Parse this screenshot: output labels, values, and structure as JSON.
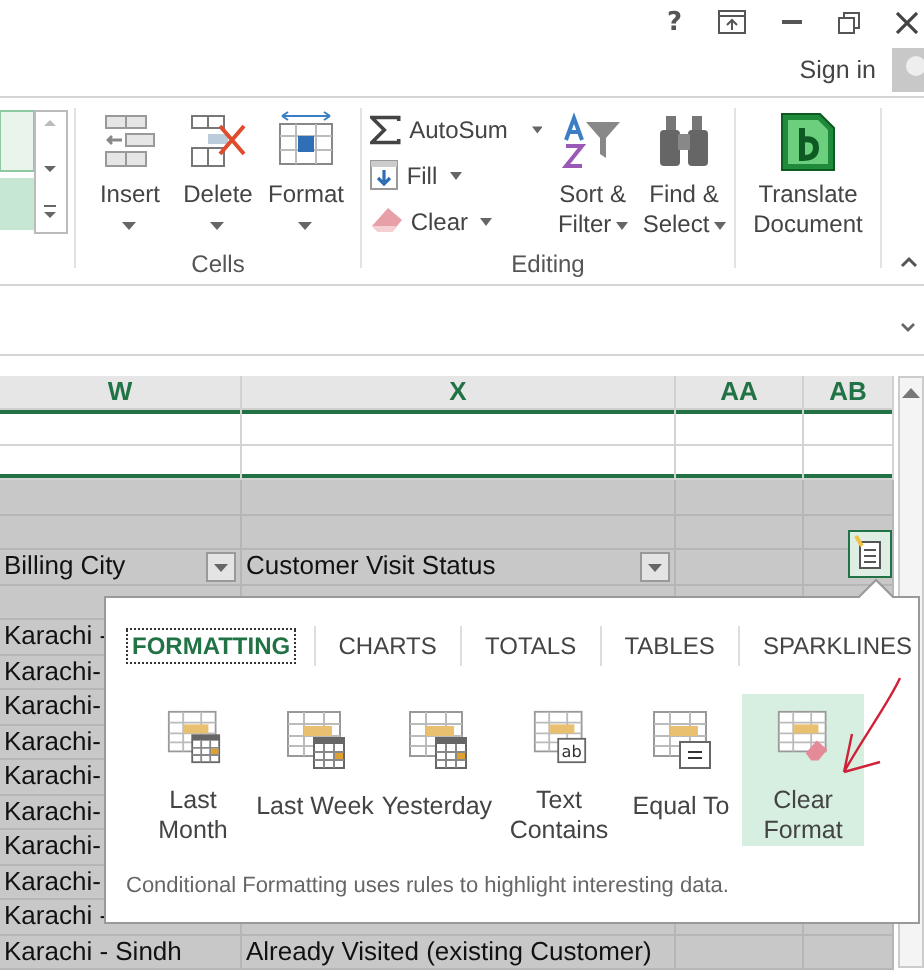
{
  "title_bar": {
    "help": "?"
  },
  "account": {
    "sign_in": "Sign in"
  },
  "ribbon": {
    "cells_group": {
      "label": "Cells",
      "buttons": [
        {
          "label": "Insert"
        },
        {
          "label": "Delete"
        },
        {
          "label": "Format"
        }
      ]
    },
    "editing_group": {
      "label": "Editing",
      "small_buttons": [
        {
          "label": "AutoSum"
        },
        {
          "label": "Fill"
        },
        {
          "label": "Clear"
        }
      ],
      "large_buttons": [
        {
          "lines": [
            "Sort &",
            "Filter"
          ]
        },
        {
          "lines": [
            "Find &",
            "Select"
          ]
        }
      ]
    },
    "translate_button": {
      "lines": [
        "Translate",
        "Document"
      ]
    }
  },
  "sheet": {
    "columns": [
      "W",
      "X",
      "AA",
      "AB"
    ],
    "header_row": [
      "Billing City",
      "Customer Visit Status"
    ],
    "rows": [
      [],
      [
        "Karachi -"
      ],
      [
        "Karachi-"
      ],
      [
        "Karachi-"
      ],
      [
        "Karachi-"
      ],
      [
        "Karachi-"
      ],
      [
        "Karachi-"
      ],
      [
        "Karachi-"
      ],
      [
        "Karachi-"
      ],
      [
        "Karachi -"
      ],
      [
        "Karachi - Sindh",
        "Already Visited (existing Customer)"
      ]
    ]
  },
  "quick_analysis": {
    "tabs": [
      {
        "label": "FORMATTING",
        "selected": true
      },
      {
        "label": "CHARTS",
        "selected": false
      },
      {
        "label": "TOTALS",
        "selected": false
      },
      {
        "label": "TABLES",
        "selected": false
      },
      {
        "label": "SPARKLINES",
        "selected": false
      }
    ],
    "options": [
      {
        "kind": "calendar",
        "lines": [
          "Last",
          "Month"
        ],
        "selected": false
      },
      {
        "kind": "calendar",
        "lines": [
          "Last Week"
        ],
        "selected": false
      },
      {
        "kind": "calendar",
        "lines": [
          "Yesterday"
        ],
        "selected": false
      },
      {
        "kind": "text",
        "lines": [
          "Text",
          "Contains"
        ],
        "icon_text": "ab",
        "selected": false
      },
      {
        "kind": "equal",
        "lines": [
          "Equal To"
        ],
        "selected": false
      },
      {
        "kind": "clear",
        "lines": [
          "Clear",
          "Format"
        ],
        "selected": true
      }
    ],
    "footer": "Conditional Formatting uses rules to highlight interesting data."
  }
}
